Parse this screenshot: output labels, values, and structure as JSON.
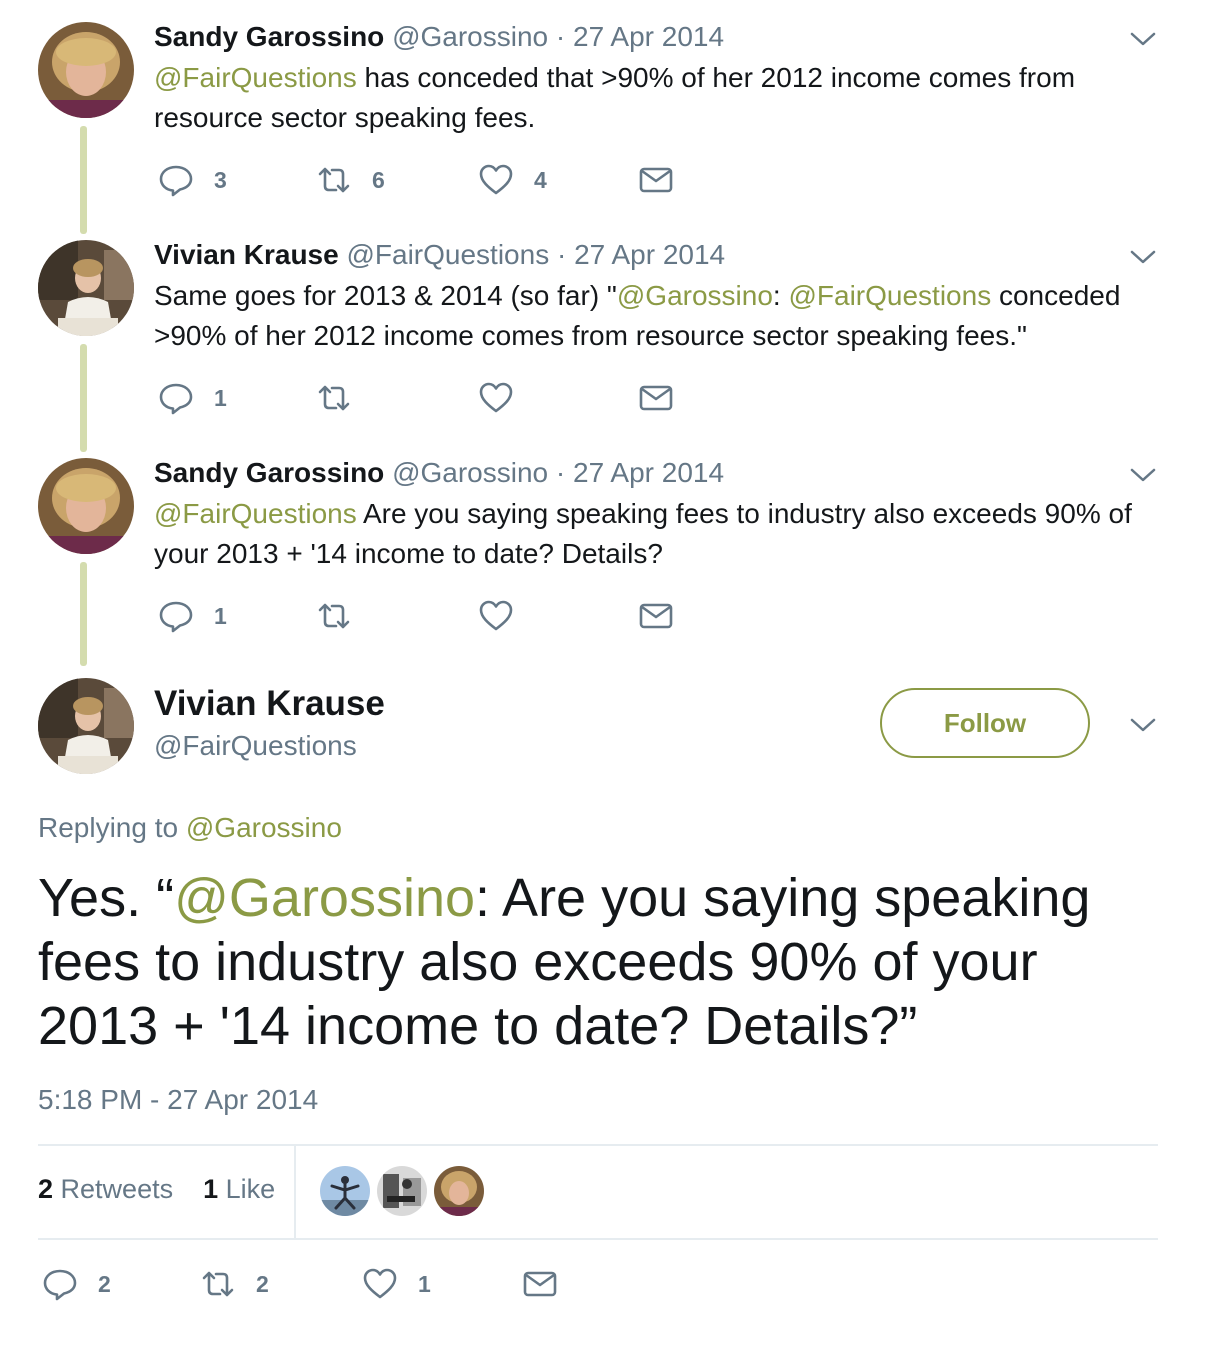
{
  "tweets": [
    {
      "name": "Sandy Garossino",
      "handle": "@Garossino",
      "date": "· 27 Apr 2014",
      "text_parts": [
        {
          "text": "@FairQuestions",
          "mention": true
        },
        {
          "text": " has conceded that >90% of her 2012 income comes from resource sector speaking fees.",
          "mention": false
        }
      ],
      "replies": "3",
      "retweets": "6",
      "likes": "4"
    },
    {
      "name": "Vivian Krause",
      "handle": "@FairQuestions",
      "date": "· 27 Apr 2014",
      "text_parts": [
        {
          "text": "Same goes for 2013 & 2014 (so far) \"",
          "mention": false
        },
        {
          "text": "@Garossino",
          "mention": true
        },
        {
          "text": ": ",
          "mention": false
        },
        {
          "text": "@FairQuestions",
          "mention": true
        },
        {
          "text": " conceded >90% of her 2012 income comes from resource sector speaking fees.\"",
          "mention": false
        }
      ],
      "replies": "1",
      "retweets": "",
      "likes": ""
    },
    {
      "name": "Sandy Garossino",
      "handle": "@Garossino",
      "date": "· 27 Apr 2014",
      "text_parts": [
        {
          "text": "@FairQuestions",
          "mention": true
        },
        {
          "text": " Are you saying speaking fees to industry also exceeds 90% of your 2013 + '14 income to date? Details?",
          "mention": false
        }
      ],
      "replies": "1",
      "retweets": "",
      "likes": ""
    }
  ],
  "main": {
    "name": "Vivian Krause",
    "handle": "@FairQuestions",
    "follow_label": "Follow",
    "replying_prefix": "Replying to ",
    "replying_to": "@Garossino",
    "text_parts": [
      {
        "text": "Yes. “",
        "mention": false
      },
      {
        "text": "@Garossino",
        "mention": true
      },
      {
        "text": ": Are you saying speaking fees to industry also exceeds 90% of your 2013 + '14 income to date? Details?”",
        "mention": false
      }
    ],
    "timestamp": "5:18 PM - 27 Apr 2014",
    "retweet_count": "2",
    "retweet_label": " Retweets",
    "like_count": "1",
    "like_label": " Like",
    "replies": "2",
    "retweets": "2",
    "likes": "1"
  },
  "colors": {
    "accent": "#8b9a45",
    "thread_line": "#d4dcae",
    "muted": "#657786",
    "text": "#14171a"
  },
  "icons": [
    "reply-icon",
    "retweet-icon",
    "like-icon",
    "message-icon",
    "chevron-down-icon"
  ]
}
